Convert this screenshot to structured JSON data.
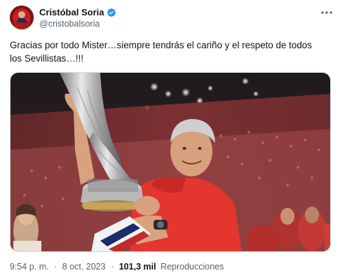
{
  "author": {
    "display_name": "Cristóbal Soria",
    "handle": "@cristobalsoria",
    "verified": true
  },
  "tweet": {
    "text_line1": "Gracias por todo Mister…siempre tendrás el cariño y el respeto de todos",
    "text_line2": "los Sevillistas…!!!"
  },
  "meta": {
    "time": "9:54 p. m.",
    "date": "8 oct. 2023",
    "separator": "·",
    "views_count": "101,3 mil",
    "views_label": "Reproducciones"
  },
  "icons": {
    "more": "more-horizontal-icon",
    "verified": "verified-badge-icon"
  },
  "colors": {
    "verified_blue": "#1d9bf0",
    "secondary_text": "#536471"
  }
}
